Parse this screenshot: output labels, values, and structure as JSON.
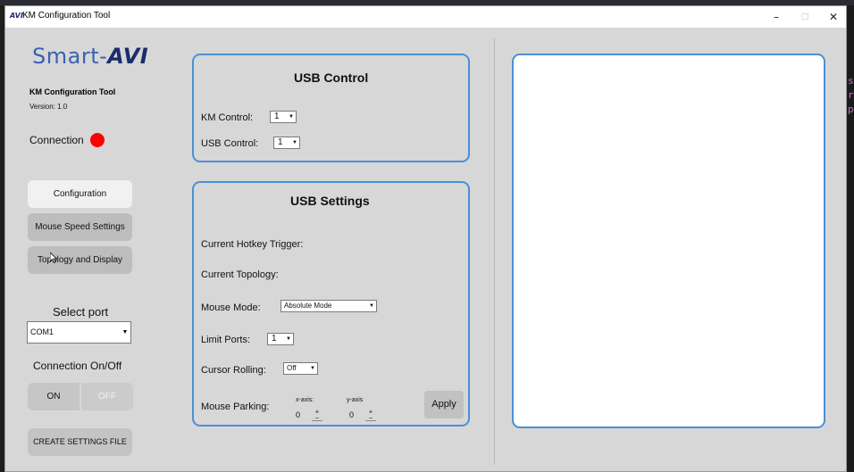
{
  "window": {
    "title": "KM Configuration Tool",
    "title_logo": "AVI",
    "controls": {
      "minimize": "–",
      "maximize": "□",
      "close": "✕"
    }
  },
  "sidebar": {
    "brand_text": "Smart-",
    "brand_mark": "AVI",
    "app_name": "KM Configuration Tool",
    "version": "Version: 1.0",
    "connection_label": "Connection",
    "connection_status_color": "#ff0000",
    "nav": [
      {
        "label": "Configuration",
        "active": true
      },
      {
        "label": "Mouse Speed Settings",
        "active": false
      },
      {
        "label": "Topology and Display",
        "active": false
      }
    ],
    "select_port_label": "Select port",
    "port_value": "COM1",
    "connection_onoff_label": "Connection On/Off",
    "on_label": "ON",
    "off_label": "OFF",
    "create_settings_label": "CREATE SETTINGS FILE"
  },
  "usb_control": {
    "title": "USB Control",
    "km_control_label": "KM Control:",
    "km_control_value": "1",
    "usb_control_label": "USB Control:",
    "usb_control_value": "1"
  },
  "usb_settings": {
    "title": "USB Settings",
    "hotkey_label": "Current Hotkey Trigger:",
    "topology_label": "Current Topology:",
    "mouse_mode_label": "Mouse Mode:",
    "mouse_mode_value": "Absolute Mode",
    "limit_ports_label": "Limit Ports:",
    "limit_ports_value": "1",
    "cursor_rolling_label": "Cursor Rolling:",
    "cursor_rolling_value": "Off",
    "mouse_parking_label": "Mouse Parking:",
    "x_axis_label": "x-axis:",
    "y_axis_label": "y-axis",
    "x_value": "0",
    "y_value": "0",
    "apply_label": "Apply"
  },
  "colors": {
    "accent": "#4a8fd6",
    "brand": "#3a61b4",
    "brand_dark": "#1a2d6b",
    "status_disconnected": "#ff0000"
  },
  "background_fragments": [
    "s",
    "r",
    "p"
  ]
}
